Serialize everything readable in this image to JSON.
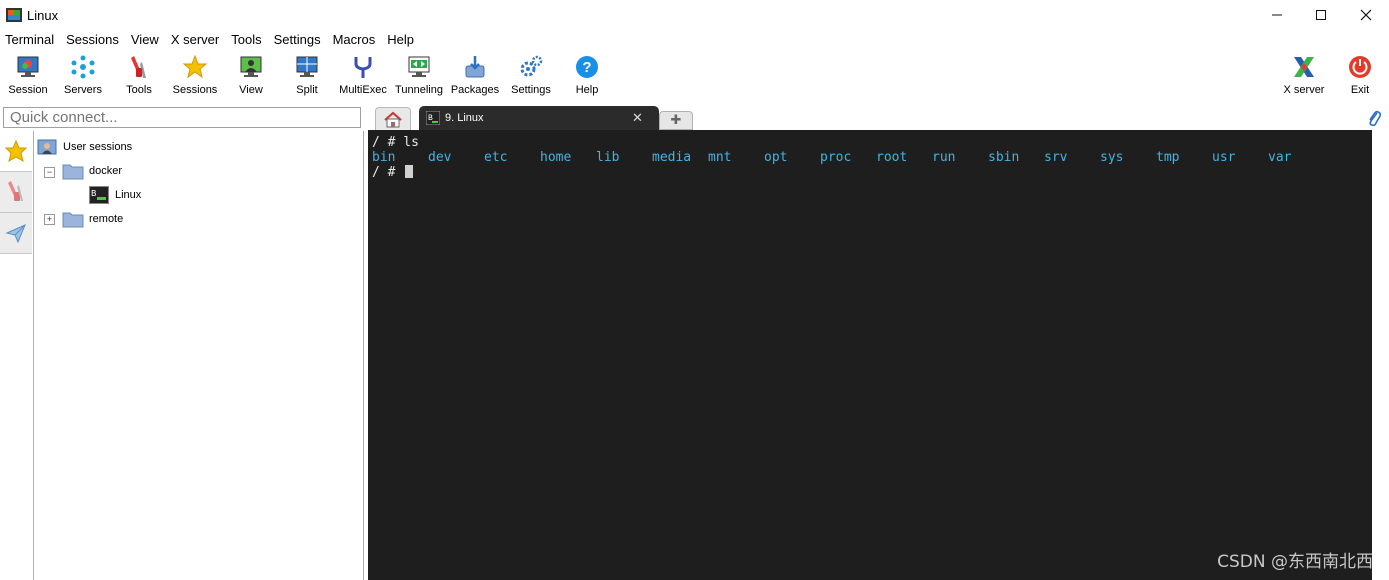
{
  "window": {
    "title": "Linux"
  },
  "menu": [
    "Terminal",
    "Sessions",
    "View",
    "X server",
    "Tools",
    "Settings",
    "Macros",
    "Help"
  ],
  "toolbar": {
    "session": "Session",
    "servers": "Servers",
    "tools": "Tools",
    "sessions": "Sessions",
    "view": "View",
    "split": "Split",
    "multiexec": "MultiExec",
    "tunneling": "Tunneling",
    "packages": "Packages",
    "settings": "Settings",
    "help": "Help",
    "xserver": "X server",
    "exit": "Exit"
  },
  "quick_connect": {
    "placeholder": "Quick connect..."
  },
  "tabs": {
    "active_title": "9. Linux"
  },
  "tree": {
    "root": "User sessions",
    "docker": "docker",
    "linux": "Linux",
    "remote": "remote"
  },
  "terminal": {
    "prompt1": "/ # ls",
    "prompt2": "/ # ",
    "ls_output": [
      "bin",
      "dev",
      "etc",
      "home",
      "lib",
      "media",
      "mnt",
      "opt",
      "proc",
      "root",
      "run",
      "sbin",
      "srv",
      "sys",
      "tmp",
      "usr",
      "var"
    ]
  },
  "watermark": "CSDN @东西南北西",
  "colors": {
    "terminal_bg": "#1e1e1e",
    "dir_color": "#3fb4e6"
  }
}
